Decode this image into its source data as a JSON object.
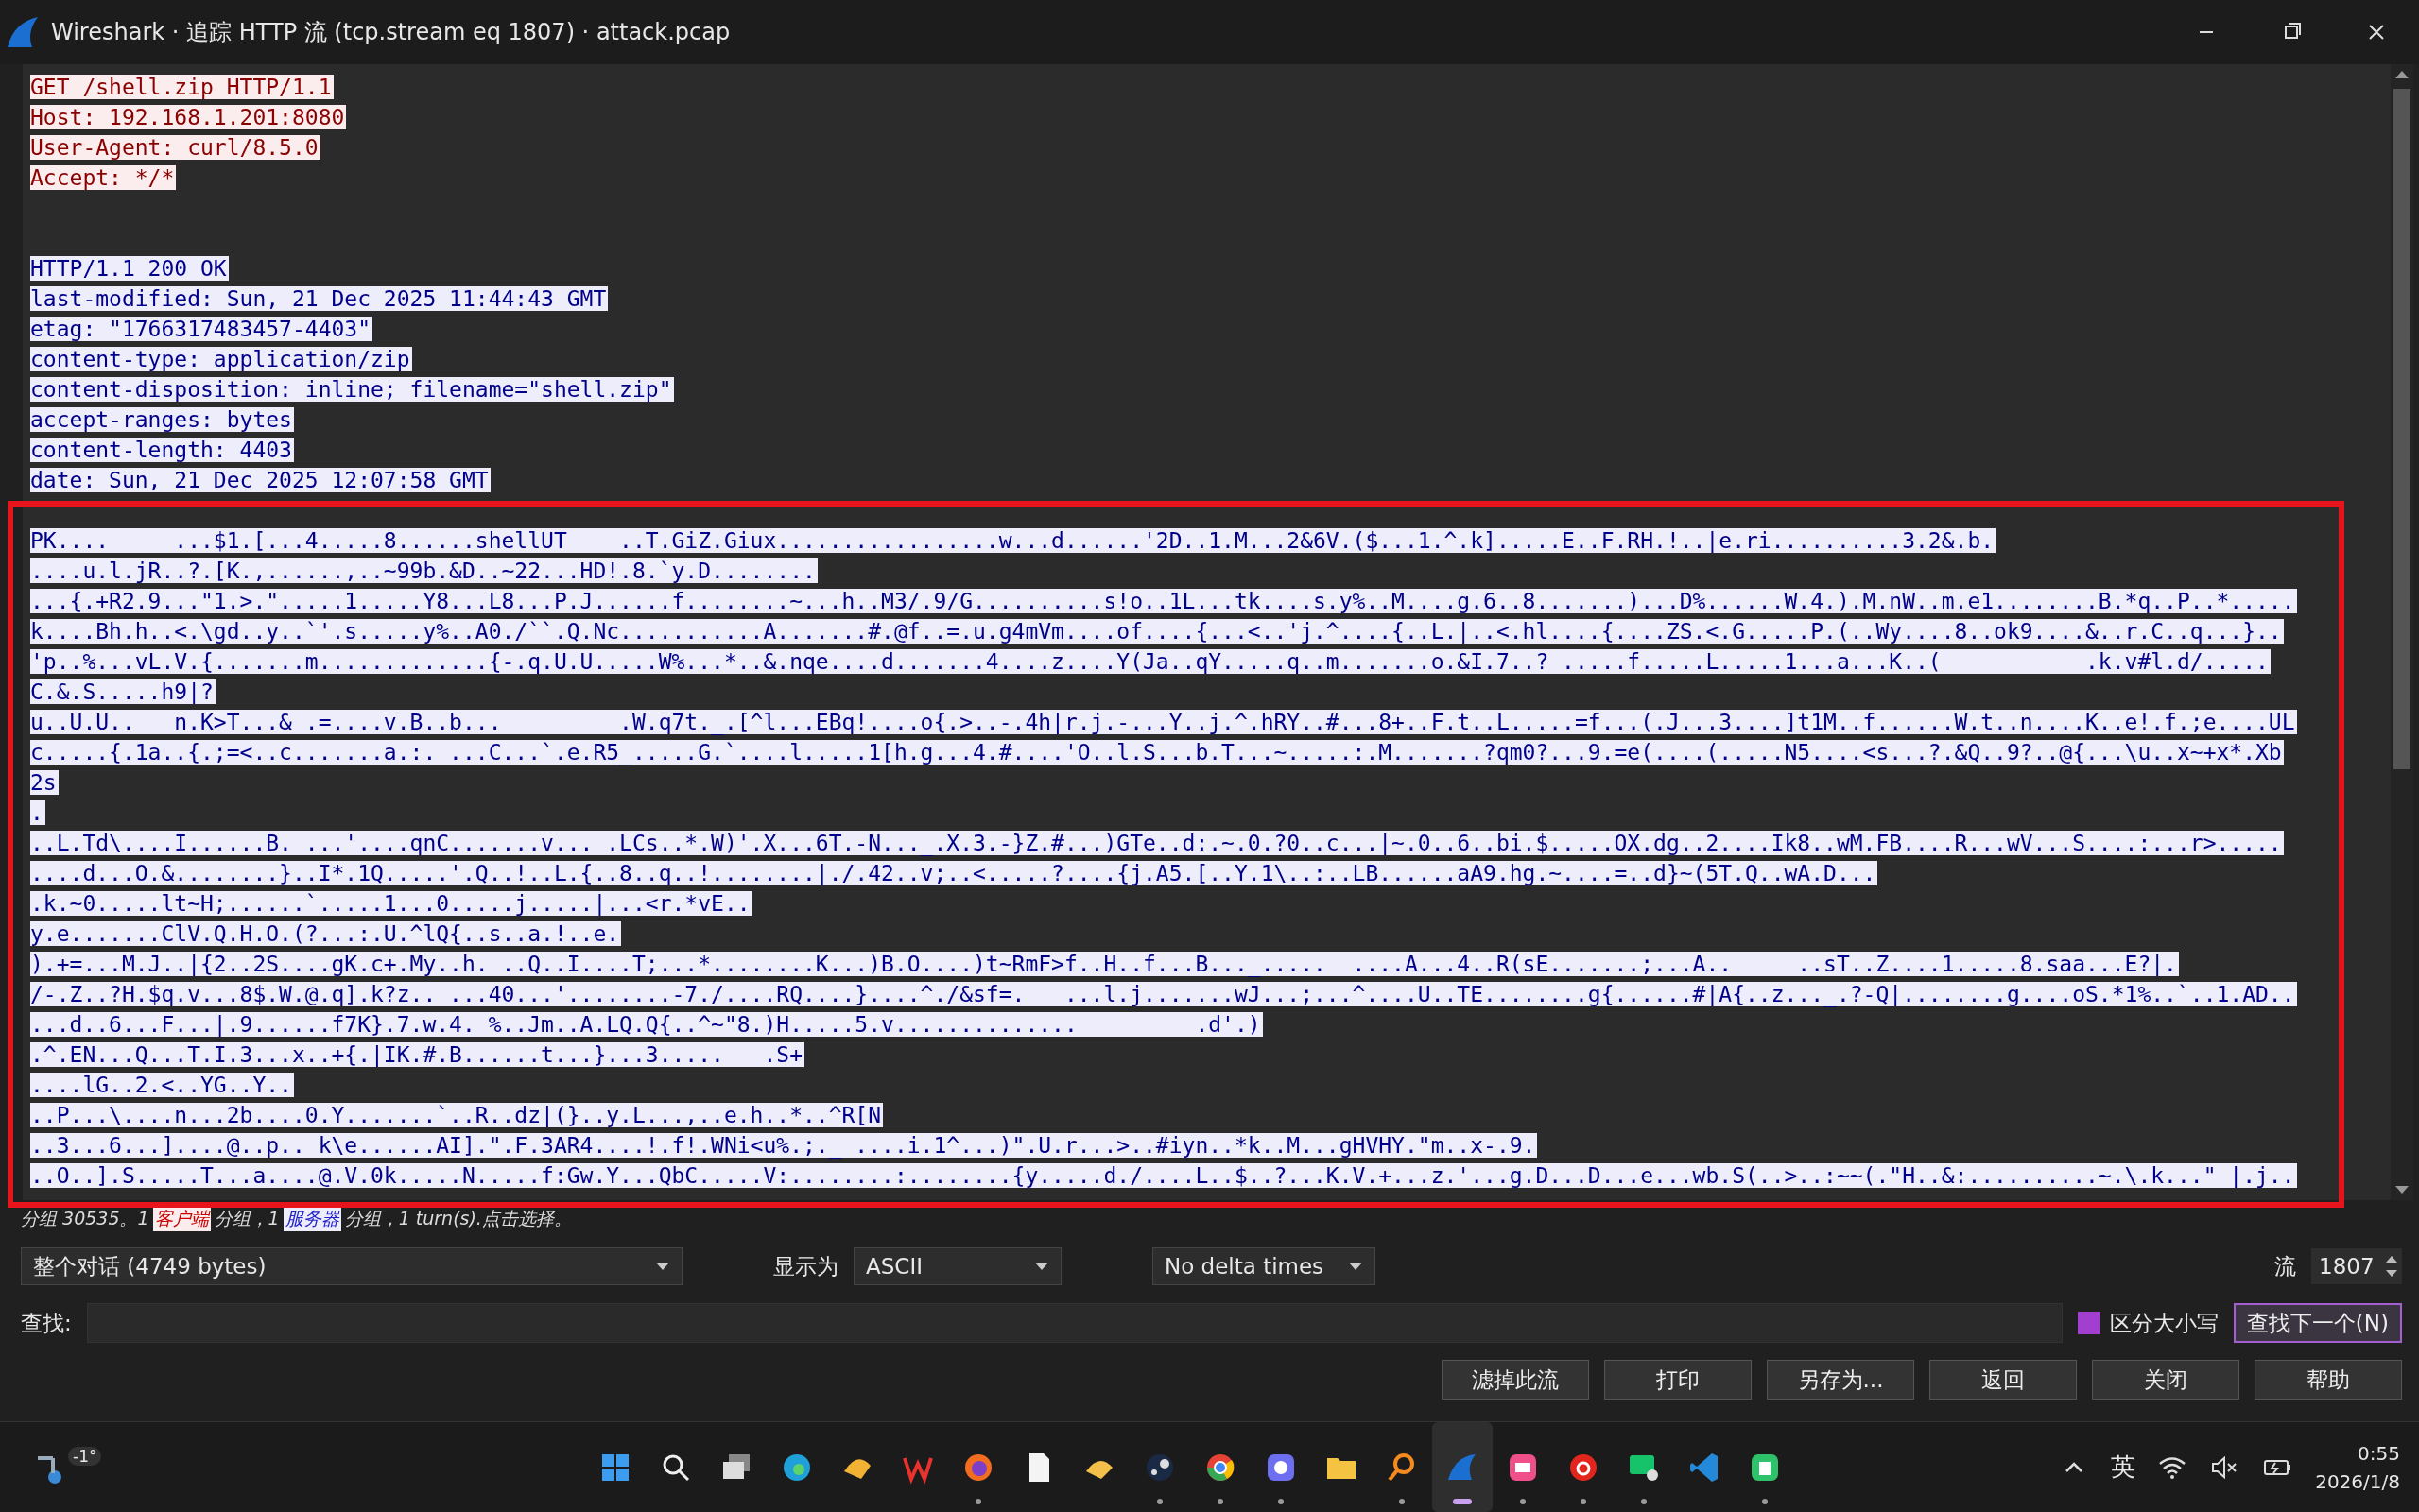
{
  "window": {
    "title": "Wireshark · 追踪 HTTP 流 (tcp.stream eq 1807) · attack.pcap"
  },
  "stream": [
    {
      "kind": "client",
      "text": "GET /shell.zip HTTP/1.1"
    },
    {
      "kind": "client",
      "text": "Host: 192.168.1.201:8080"
    },
    {
      "kind": "client",
      "text": "User-Agent: curl/8.5.0"
    },
    {
      "kind": "client",
      "text": "Accept: */*"
    },
    {
      "kind": "server_header",
      "text": "HTTP/1.1 200 OK"
    },
    {
      "kind": "server_header",
      "text": "last-modified: Sun, 21 Dec 2025 11:44:43 GMT"
    },
    {
      "kind": "server_header",
      "text": "etag: \"1766317483457-4403\""
    },
    {
      "kind": "server_header",
      "text": "content-type: application/zip"
    },
    {
      "kind": "server_header",
      "text": "content-disposition: inline; filename=\"shell.zip\""
    },
    {
      "kind": "server_header",
      "text": "accept-ranges: bytes"
    },
    {
      "kind": "server_header",
      "text": "content-length: 4403"
    },
    {
      "kind": "server_header",
      "text": "date: Sun, 21 Dec 2025 12:07:58 GMT"
    },
    {
      "kind": "server_body",
      "text": "PK....     ...$1.[...4.....8......shellUT    ..T.GiZ.Giux.................w...d......'2D..1.M...2&6V.($...1.^.k].....E..F.RH.!..|e.ri..........3.2&.b."
    },
    {
      "kind": "server_body",
      "text": "....u.l.jR..?.[K.,......,..~99b.&D..~22...HD!.8.`y.D........"
    },
    {
      "kind": "server_body",
      "text": "...{.+R2.9...\"1.>.\".....1.....Y8...L8...P.J......f........~...h..M3/.9/G..........s!o..1L...tk....s.y%..M....g.6..8.......)...D%......W.4.).M.nW..m.e1........B.*q..P..*....."
    },
    {
      "kind": "server_body",
      "text": "k....Bh.h..<.\\gd..y..`'.s.....y%..A0./``.Q.Nc...........A.......#.@f..=.u.g4mVm....of....{...<..'j.^....{..L.|..<.hl....{....ZS.<.G.....P.(..Wy....8..ok9....&..r.C..q...}.."
    },
    {
      "kind": "server_body",
      "text": "'p..%...vL.V.{.......m.............{-.q.U.U.....W%...*..&.nqe....d.......4....z....Y(Ja..qY.....q..m.......o.&I.7..? .....f.....L.....1...a...K..(           .k.v#l.d/....."
    },
    {
      "kind": "server_body",
      "text": "C.&.S.....h9|?"
    },
    {
      "kind": "server_body",
      "text": "u..U.U..   n.K>T...& .=....v.B..b...         .W.q7t._.[^l...EBq!....o{.>..-.4h|r.j.-...Y..j.^.hRY..#...8+..F.t..L.....=f...(.J...3....]t1M..f......W.t..n....K..e!.f.;e....UL"
    },
    {
      "kind": "server_body",
      "text": "c.....{.1a..{.;=<..c.......a.:. ...C...`.e.R5_.....G.`....l.....1[h.g...4.#....'O..l.S...b.T...~.....:.M.......?qm0?...9.=e(....(.....N5....<s...?.&Q..9?..@{...\\u..x~+x*.Xb"
    },
    {
      "kind": "server_body",
      "text": "2s"
    },
    {
      "kind": "server_body",
      "text": "."
    },
    {
      "kind": "server_body",
      "text": "..L.Td\\....I......B. ...'....qnC.......v... .LCs..*.W)'.X...6T.-N..._.X.3.-}Z.#...)GTe..d:.~.0.?0..c...|~.0..6..bi.$.....OX.dg..2....Ik8..wM.FB....R...wV...S....:...r>....."
    },
    {
      "kind": "server_body",
      "text": "....d...O.&........}..I*.1Q.....'.Q..!..L.{..8..q..!........|./.42..v;..<.....?....{j.A5.[..Y.1\\..:..LB......aA9.hg.~....=..d}~(5T.Q..wA.D..."
    },
    {
      "kind": "server_body",
      "text": ".k.~0.....lt~H;......`.....1...0.....j.....|...<r.*vE.."
    },
    {
      "kind": "server_body",
      "text": "y.e.......ClV.Q.H.O.(?...:.U.^lQ{..s..a.!..e."
    },
    {
      "kind": "server_body",
      "text": ").+=...M.J..|{2..2S....gK.c+.My..h. ..Q..I....T;...*........K...)B.O....)t~RmF>f..H..f...B..._.....  ....A...4..R(sE.......;...A..     ..sT..Z....1.....8.saa...E?|."
    },
    {
      "kind": "server_body",
      "text": "/-.Z..?H.$q.v...8$.W.@.q].k?z.. ...40...'........-7./....RQ....}....^./&sf=.   ...l.j.......wJ...;...^....U..TE........g{......#|A{..z..._.?-Q|........g....oS.*1%..`..1.AD.."
    },
    {
      "kind": "server_body",
      "text": "...d..6...F...|.9......f7K}.7.w.4. %..Jm..A.LQ.Q{..^~\"8.)H.....5.v..............         .d'.)"
    },
    {
      "kind": "server_body",
      "text": ".^.EN...Q...T.I.3...x..+{.|IK.#.B......t...}...3.....   .S+"
    },
    {
      "kind": "server_body",
      "text": "....lG..2.<..YG..Y.."
    },
    {
      "kind": "server_body",
      "text": "..P...\\....n...2b....0.Y.......`..R..dz|(}..y.L...,..e.h..*..^R[N"
    },
    {
      "kind": "server_body",
      "text": "..3...6...]....@..p.. k\\e......AI].\".F.3AR4....!.f!.WNi<u%.;._ ....i.1^...)\".U.r...>..#iyn..*k..M...gHVHY.\"m..x-.9."
    },
    {
      "kind": "server_body",
      "text": "..O..].S.....T...a....@.V.0k.....N.....f:Gw.Y...QbC.....V:........:........{y.....d./....L..$..?...K.V.+...z.'...g.D...D...e...wb.S(..>..:~~(.\"H..&:..........~.\\.k...\" |.j.."
    }
  ],
  "status": [
    {
      "kind": "text",
      "text": "分组 30535。1"
    },
    {
      "kind": "client",
      "text": "客户端"
    },
    {
      "kind": "text",
      "text": "分组，1"
    },
    {
      "kind": "server",
      "text": "服务器"
    },
    {
      "kind": "text",
      "text": "分组，1 turn(s).点击选择。"
    }
  ],
  "conversation_select": {
    "value": "整个对话 (4749 bytes)"
  },
  "show_as": {
    "label": "显示为",
    "value": "ASCII"
  },
  "delta_select": {
    "value": "No delta times"
  },
  "stream_number": {
    "label": "流",
    "value": "1807"
  },
  "find": {
    "label": "查找:",
    "case_sensitive": {
      "label": "区分大小写",
      "checked": false
    },
    "button": "查找下一个(N)"
  },
  "buttons": [
    "滤掉此流",
    "打印",
    "另存为...",
    "返回",
    "关闭",
    "帮助"
  ],
  "taskbar": {
    "weather": "-1°",
    "apps": [
      {
        "running": false,
        "selected": false
      },
      {
        "running": false,
        "selected": false
      },
      {
        "running": false,
        "selected": false
      },
      {
        "running": false,
        "selected": false
      },
      {
        "running": false,
        "selected": false
      },
      {
        "running": false,
        "selected": false
      },
      {
        "running": true,
        "selected": false
      },
      {
        "running": false,
        "selected": false
      },
      {
        "running": false,
        "selected": false
      },
      {
        "running": true,
        "selected": false
      },
      {
        "running": true,
        "selected": false
      },
      {
        "running": true,
        "selected": false
      },
      {
        "running": false,
        "selected": false
      },
      {
        "running": true,
        "selected": false
      },
      {
        "running": true,
        "selected": true
      },
      {
        "running": true,
        "selected": false
      },
      {
        "running": true,
        "selected": false
      },
      {
        "running": true,
        "selected": false
      },
      {
        "running": false,
        "selected": false
      },
      {
        "running": true,
        "selected": false
      }
    ],
    "ime": "英",
    "time": "0:55",
    "date": "2026/1/8"
  }
}
